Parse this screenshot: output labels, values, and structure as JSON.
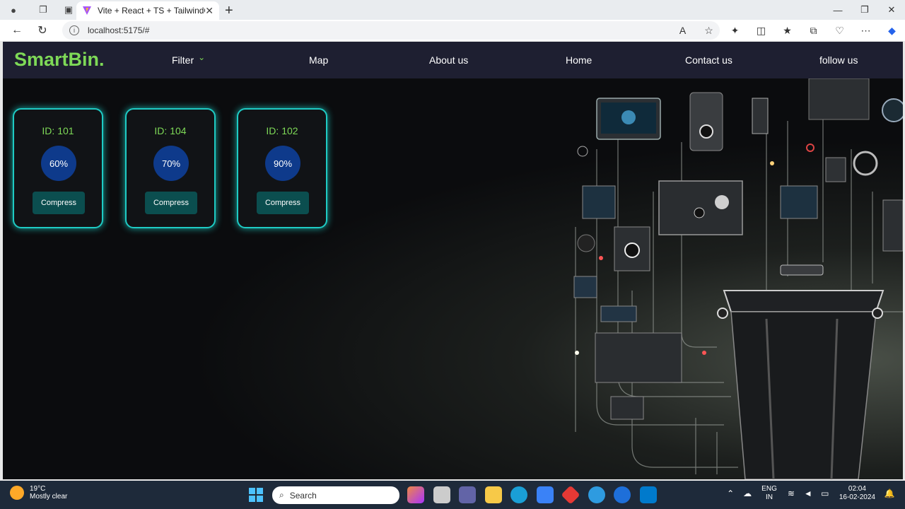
{
  "browser": {
    "tab_title": "Vite + React + TS + TailwindCSS",
    "url": "localhost:5175/#"
  },
  "navbar": {
    "brand": "SmartBin.",
    "items": [
      "Filter",
      "Map",
      "About us",
      "Home",
      "Contact us",
      "follow us"
    ]
  },
  "bins": [
    {
      "id_label": "ID: 101",
      "fill": "60%",
      "action": "Compress"
    },
    {
      "id_label": "ID: 104",
      "fill": "70%",
      "action": "Compress"
    },
    {
      "id_label": "ID: 102",
      "fill": "90%",
      "action": "Compress"
    }
  ],
  "taskbar": {
    "temperature": "19°C",
    "weather": "Mostly clear",
    "search_placeholder": "Search",
    "language_top": "ENG",
    "language_bottom": "IN",
    "time": "02:04",
    "date": "16-02-2024"
  },
  "colors": {
    "brand_green": "#7ed957",
    "navbar_bg": "#1e1f31",
    "card_border": "#1ecbc4",
    "gauge_blue": "#0e3a8b",
    "button_teal": "#0b4e4f"
  }
}
